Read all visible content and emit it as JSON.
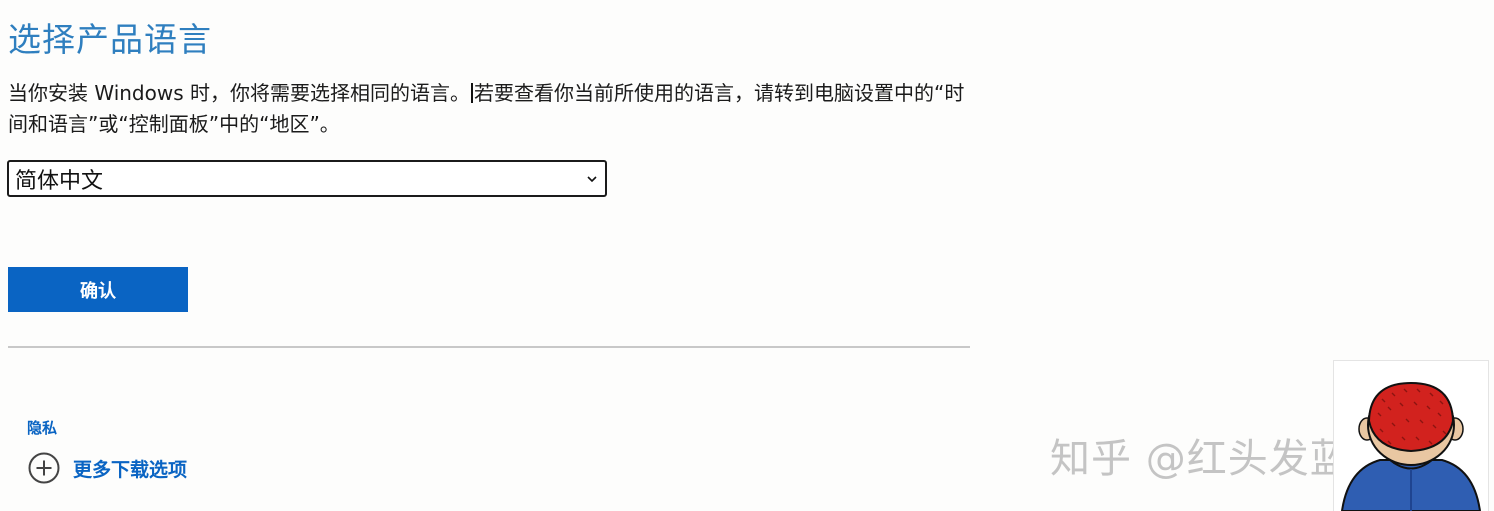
{
  "page": {
    "title": "选择产品语言",
    "description_part1": "当你安装 Windows 时，你将需要选择相同的语言。",
    "description_part2": "若要查看你当前所使用的语言，请转到电脑设置中的“时间和语言”或“控制面板”中的“地区”。"
  },
  "language_select": {
    "selected": "简体中文"
  },
  "confirm_button": {
    "label": "确认"
  },
  "footer": {
    "privacy_label": "隐私",
    "more_downloads_label": "更多下载选项"
  },
  "watermark": {
    "text": "知乎 @红头发蓝胖子"
  },
  "colors": {
    "title": "#2f7fbf",
    "accent": "#0a64c3",
    "divider": "#c8c8c8"
  }
}
